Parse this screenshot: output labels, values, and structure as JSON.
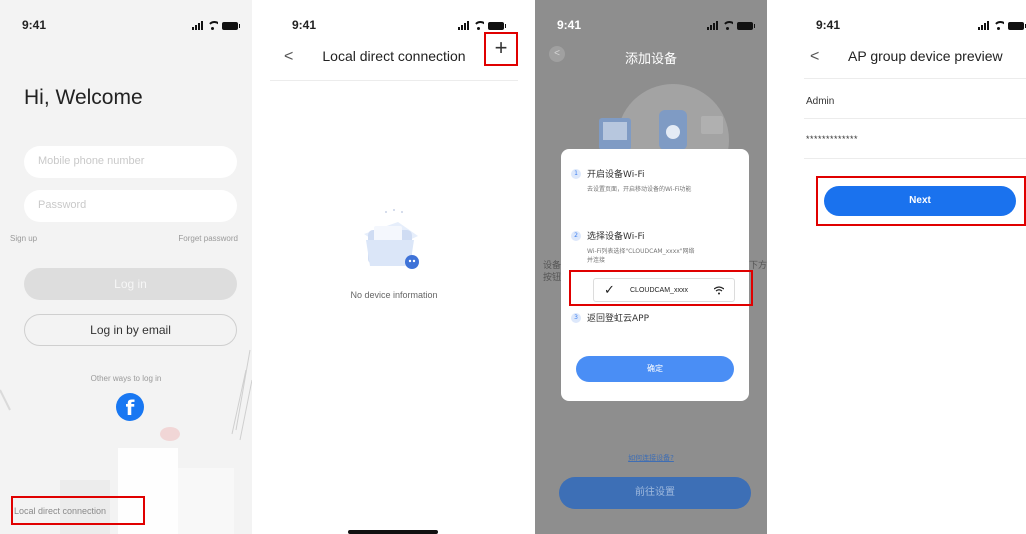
{
  "status_bar": {
    "time": "9:41"
  },
  "screen1": {
    "greeting": "Hi, Welcome",
    "phone_placeholder": "Mobile phone number",
    "password_placeholder": "Password",
    "sign_up": "Sign up",
    "forget_password": "Forget password",
    "login_button": "Log in",
    "email_login_button": "Log in by email",
    "other_ways": "Other ways to log in",
    "facebook_glyph": "f",
    "local_direct_connection": "Local direct connection"
  },
  "screen2": {
    "back_glyph": "<",
    "title": "Local direct connection",
    "add_glyph": "+",
    "empty_text": "No device information"
  },
  "screen3": {
    "title": "添加设备",
    "behind_left": "设备",
    "behind_left2": "按钮",
    "behind_right": "下方",
    "step1_title": "开启设备Wi-Fi",
    "step1_desc": "去设置页面，开启移动设备的Wi-Fi功能",
    "step2_title": "选择设备Wi-Fi",
    "step2_desc_line1": "Wi-Fi列表选择\"CLOUDCAM_xxxx\"网络",
    "step2_desc_line2": "并连接",
    "wifi_ssid": "CLOUDCAM_xxxx",
    "step3_title": "返回登虹云APP",
    "confirm": "确定",
    "how_to_connect": "如何连接设备?",
    "go_settings": "前往设置"
  },
  "screen4": {
    "back_glyph": "<",
    "title": "AP group device preview",
    "username": "Admin",
    "password_masked": "*************",
    "next_button": "Next"
  },
  "colors": {
    "highlight": "#e00000",
    "primary_blue": "#1a72ee",
    "facebook_blue": "#1877f2"
  }
}
